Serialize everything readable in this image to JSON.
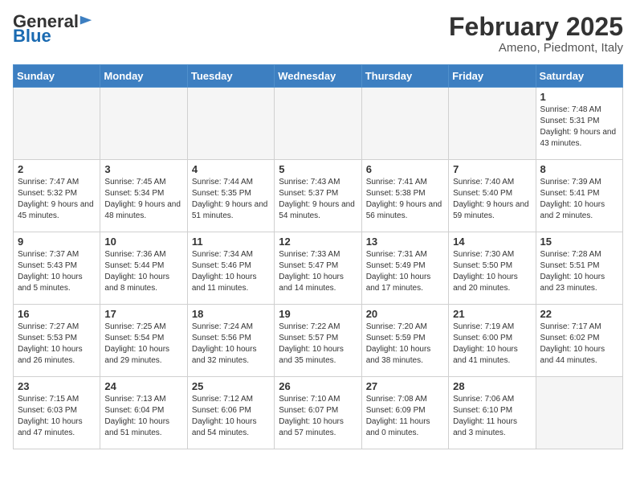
{
  "header": {
    "logo_general": "General",
    "logo_blue": "Blue",
    "month_year": "February 2025",
    "location": "Ameno, Piedmont, Italy"
  },
  "weekdays": [
    "Sunday",
    "Monday",
    "Tuesday",
    "Wednesday",
    "Thursday",
    "Friday",
    "Saturday"
  ],
  "weeks": [
    [
      {
        "day": "",
        "info": ""
      },
      {
        "day": "",
        "info": ""
      },
      {
        "day": "",
        "info": ""
      },
      {
        "day": "",
        "info": ""
      },
      {
        "day": "",
        "info": ""
      },
      {
        "day": "",
        "info": ""
      },
      {
        "day": "1",
        "info": "Sunrise: 7:48 AM\nSunset: 5:31 PM\nDaylight: 9 hours and 43 minutes."
      }
    ],
    [
      {
        "day": "2",
        "info": "Sunrise: 7:47 AM\nSunset: 5:32 PM\nDaylight: 9 hours and 45 minutes."
      },
      {
        "day": "3",
        "info": "Sunrise: 7:45 AM\nSunset: 5:34 PM\nDaylight: 9 hours and 48 minutes."
      },
      {
        "day": "4",
        "info": "Sunrise: 7:44 AM\nSunset: 5:35 PM\nDaylight: 9 hours and 51 minutes."
      },
      {
        "day": "5",
        "info": "Sunrise: 7:43 AM\nSunset: 5:37 PM\nDaylight: 9 hours and 54 minutes."
      },
      {
        "day": "6",
        "info": "Sunrise: 7:41 AM\nSunset: 5:38 PM\nDaylight: 9 hours and 56 minutes."
      },
      {
        "day": "7",
        "info": "Sunrise: 7:40 AM\nSunset: 5:40 PM\nDaylight: 9 hours and 59 minutes."
      },
      {
        "day": "8",
        "info": "Sunrise: 7:39 AM\nSunset: 5:41 PM\nDaylight: 10 hours and 2 minutes."
      }
    ],
    [
      {
        "day": "9",
        "info": "Sunrise: 7:37 AM\nSunset: 5:43 PM\nDaylight: 10 hours and 5 minutes."
      },
      {
        "day": "10",
        "info": "Sunrise: 7:36 AM\nSunset: 5:44 PM\nDaylight: 10 hours and 8 minutes."
      },
      {
        "day": "11",
        "info": "Sunrise: 7:34 AM\nSunset: 5:46 PM\nDaylight: 10 hours and 11 minutes."
      },
      {
        "day": "12",
        "info": "Sunrise: 7:33 AM\nSunset: 5:47 PM\nDaylight: 10 hours and 14 minutes."
      },
      {
        "day": "13",
        "info": "Sunrise: 7:31 AM\nSunset: 5:49 PM\nDaylight: 10 hours and 17 minutes."
      },
      {
        "day": "14",
        "info": "Sunrise: 7:30 AM\nSunset: 5:50 PM\nDaylight: 10 hours and 20 minutes."
      },
      {
        "day": "15",
        "info": "Sunrise: 7:28 AM\nSunset: 5:51 PM\nDaylight: 10 hours and 23 minutes."
      }
    ],
    [
      {
        "day": "16",
        "info": "Sunrise: 7:27 AM\nSunset: 5:53 PM\nDaylight: 10 hours and 26 minutes."
      },
      {
        "day": "17",
        "info": "Sunrise: 7:25 AM\nSunset: 5:54 PM\nDaylight: 10 hours and 29 minutes."
      },
      {
        "day": "18",
        "info": "Sunrise: 7:24 AM\nSunset: 5:56 PM\nDaylight: 10 hours and 32 minutes."
      },
      {
        "day": "19",
        "info": "Sunrise: 7:22 AM\nSunset: 5:57 PM\nDaylight: 10 hours and 35 minutes."
      },
      {
        "day": "20",
        "info": "Sunrise: 7:20 AM\nSunset: 5:59 PM\nDaylight: 10 hours and 38 minutes."
      },
      {
        "day": "21",
        "info": "Sunrise: 7:19 AM\nSunset: 6:00 PM\nDaylight: 10 hours and 41 minutes."
      },
      {
        "day": "22",
        "info": "Sunrise: 7:17 AM\nSunset: 6:02 PM\nDaylight: 10 hours and 44 minutes."
      }
    ],
    [
      {
        "day": "23",
        "info": "Sunrise: 7:15 AM\nSunset: 6:03 PM\nDaylight: 10 hours and 47 minutes."
      },
      {
        "day": "24",
        "info": "Sunrise: 7:13 AM\nSunset: 6:04 PM\nDaylight: 10 hours and 51 minutes."
      },
      {
        "day": "25",
        "info": "Sunrise: 7:12 AM\nSunset: 6:06 PM\nDaylight: 10 hours and 54 minutes."
      },
      {
        "day": "26",
        "info": "Sunrise: 7:10 AM\nSunset: 6:07 PM\nDaylight: 10 hours and 57 minutes."
      },
      {
        "day": "27",
        "info": "Sunrise: 7:08 AM\nSunset: 6:09 PM\nDaylight: 11 hours and 0 minutes."
      },
      {
        "day": "28",
        "info": "Sunrise: 7:06 AM\nSunset: 6:10 PM\nDaylight: 11 hours and 3 minutes."
      },
      {
        "day": "",
        "info": ""
      }
    ]
  ]
}
